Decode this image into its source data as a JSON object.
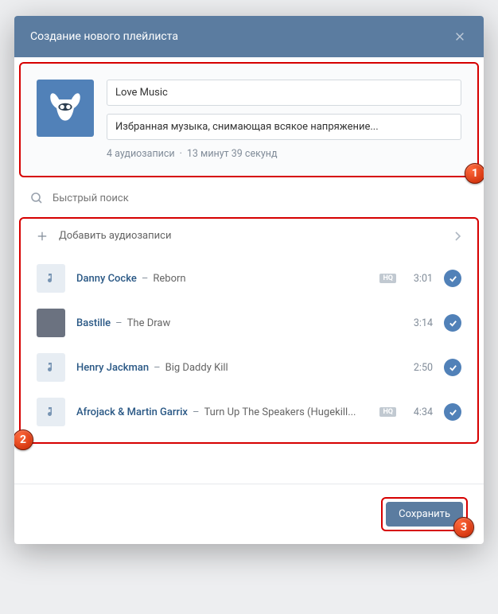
{
  "header": {
    "title": "Создание нового плейлиста"
  },
  "playlist": {
    "name": "Love Music",
    "description": "Избранная музыка, снимающая всякое напряжение...",
    "count_label": "4 аудиозаписи",
    "duration_label": "13 минут 39 секунд"
  },
  "search": {
    "placeholder": "Быстрый поиск"
  },
  "add_row": {
    "label": "Добавить аудиозаписи"
  },
  "tracks": [
    {
      "artist": "Danny Cocke",
      "title": "Reborn",
      "duration": "3:01",
      "hq": true,
      "thumb": "note"
    },
    {
      "artist": "Bastille",
      "title": "The Draw",
      "duration": "3:14",
      "hq": false,
      "thumb": "img"
    },
    {
      "artist": "Henry Jackman",
      "title": "Big Daddy Kill",
      "duration": "2:50",
      "hq": false,
      "thumb": "note"
    },
    {
      "artist": "Afrojack & Martin Garrix",
      "title": "Turn Up The Speakers (Hugekill...",
      "duration": "4:34",
      "hq": true,
      "thumb": "note"
    }
  ],
  "footer": {
    "save": "Сохранить"
  },
  "callouts": {
    "c1": "1",
    "c2": "2",
    "c3": "3"
  },
  "dash": "–"
}
